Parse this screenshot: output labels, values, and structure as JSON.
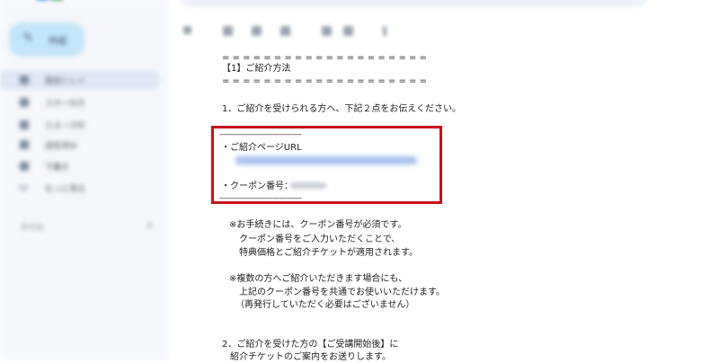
{
  "sidebar": {
    "compose_label": "作成",
    "items": [
      {
        "label": "受信トレイ"
      },
      {
        "label": "スター付き"
      },
      {
        "label": "スヌーズ中"
      },
      {
        "label": "送信済み"
      },
      {
        "label": "下書き"
      },
      {
        "label": "もっと見る"
      }
    ],
    "labels_heading": "ラベル",
    "labels_add": "+"
  },
  "mail": {
    "rule_top": "= = = = = = = = = = = = = = = = = = = =",
    "section_title": "【1】ご紹介方法",
    "rule_bottom": "= = = = = = = = = = = = = = = = = = = =",
    "step1": "1．ご紹介を受けられる方へ、下記２点をお伝えください。",
    "box_rule_top": "----------------------------------------",
    "page_url_label": "・ご紹介ページURL",
    "coupon_label": "・クーポン番号：",
    "box_rule_bottom": "----------------------------------------",
    "note1": [
      "※お手続きには、クーポン番号が必須です。",
      "クーポン番号をご入力いただくことで、",
      "特典価格とご紹介チケットが適用されます。"
    ],
    "note2": [
      "※複数の方へご紹介いただきます場合にも、",
      "上記のクーポン番号を共通でお使いいただけます。",
      "（再発行していただく必要はございません）"
    ],
    "step2": [
      "2．ご紹介を受けた方の【ご受講開始後】に",
      "紹介チケットのご案内をお送りします。"
    ]
  },
  "colors": {
    "highlight": "#c8111a",
    "sidebar_bg": "#f5f7fb",
    "compose_bg": "#c3e5f9",
    "link_blur": "#8fb3ec"
  }
}
